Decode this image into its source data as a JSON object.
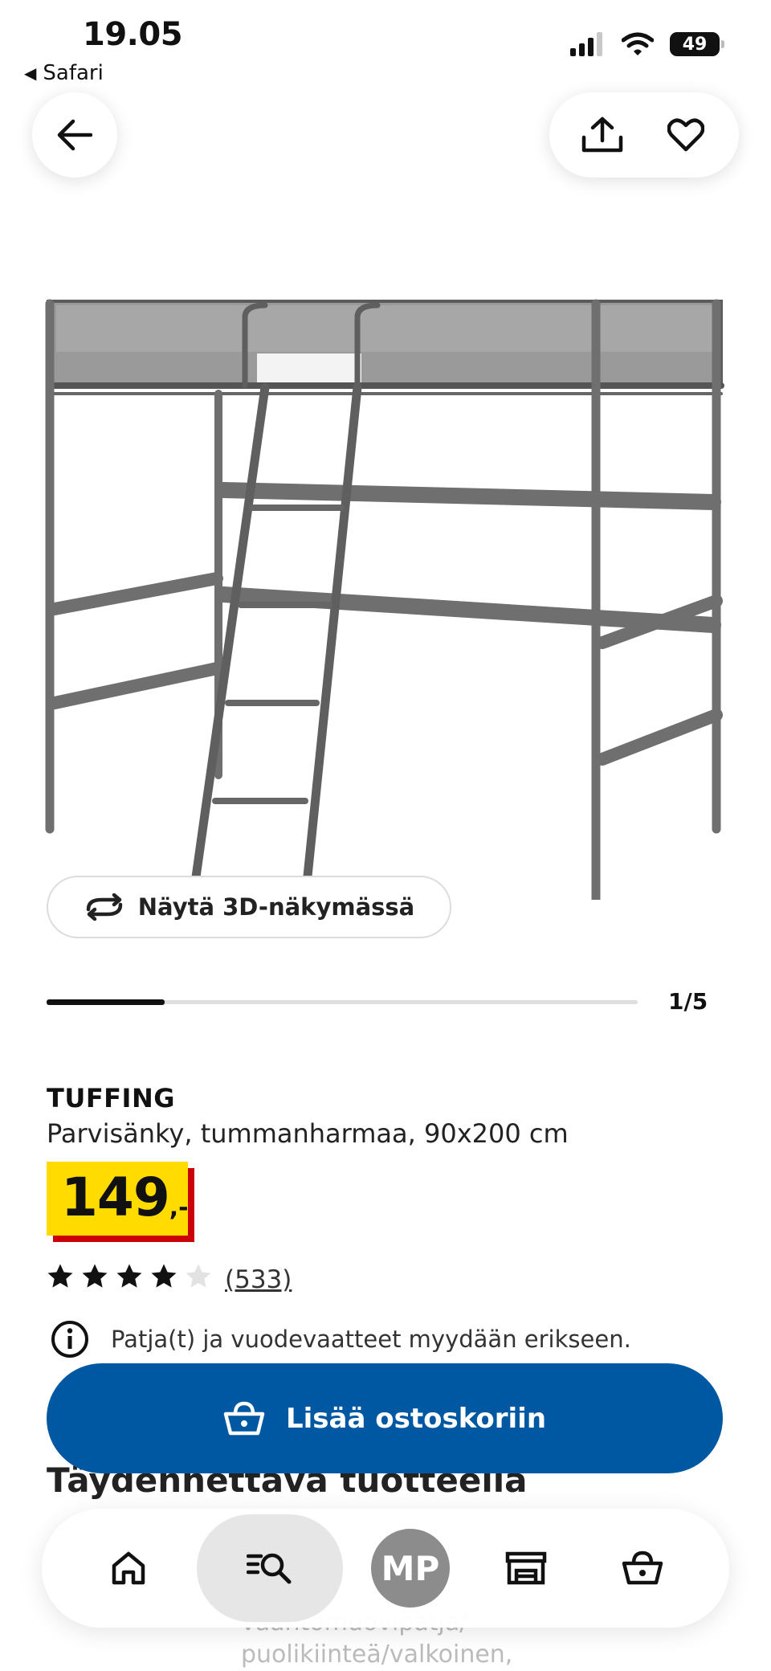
{
  "status_bar": {
    "time": "19.05",
    "back_app": "Safari",
    "battery": "49"
  },
  "product": {
    "view_3d_label": "Näytä 3D-näkymässä",
    "image_counter": "1/5",
    "image_progress": 0.2,
    "brand": "TUFFING",
    "description": "Parvisänky, tummanharmaa, 90x200 cm",
    "price_main": "149",
    "price_suffix": ",-",
    "rating": 4,
    "rating_max": 5,
    "review_count": "(533)",
    "info_text": "Patja(t) ja vuodevaatteet myydään erikseen."
  },
  "cta": {
    "add_to_cart": "Lisää ostoskoriin"
  },
  "complement": {
    "title": "Täydennettävä tuotteella",
    "partial_line1": "vaahtomuovipatja/",
    "partial_line2": "puolikiinteä/valkoinen,"
  },
  "nav": {
    "avatar_initials": "MP"
  },
  "colors": {
    "accent_blue": "#0058a3",
    "price_yellow": "#ffdb00",
    "price_red": "#cc0008",
    "frame_grey": "#6f6f6f"
  }
}
